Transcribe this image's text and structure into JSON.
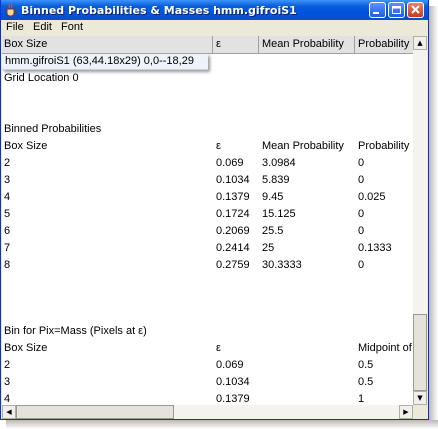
{
  "window": {
    "title": "Binned Probabilities & Masses hmm.gifroiS1"
  },
  "menu": [
    "File",
    "Edit",
    "Font"
  ],
  "header": [
    "Box Size",
    "ε",
    "Mean Probability",
    "Probability"
  ],
  "tooltip": {
    "text": "hmm.gifroiS1 (63,44.18x29) 0,0--18,29"
  },
  "grid_location": "Grid Location 0",
  "binned": {
    "title": "Binned Probabilities",
    "columns": [
      "Box Size",
      "ε",
      "Mean Probability",
      "Probability"
    ],
    "rows": [
      [
        "2",
        "0.069",
        "3.0984",
        "0"
      ],
      [
        "3",
        "0.1034",
        "5.839",
        "0"
      ],
      [
        "4",
        "0.1379",
        "9.45",
        "0.025"
      ],
      [
        "5",
        "0.1724",
        "15.125",
        "0"
      ],
      [
        "6",
        "0.2069",
        "25.5",
        "0"
      ],
      [
        "7",
        "0.2414",
        "25",
        "0.1333"
      ],
      [
        "8",
        "0.2759",
        "30.3333",
        "0"
      ]
    ]
  },
  "mass": {
    "title": "Bin for Pix=Mass (Pixels at ε)",
    "columns": [
      "Box Size",
      "ε",
      "Midpoint of"
    ],
    "rows": [
      [
        "2",
        "0.069",
        "0.5"
      ],
      [
        "3",
        "0.1034",
        "0.5"
      ],
      [
        "4",
        "0.1379",
        "1"
      ]
    ]
  },
  "scroll": {
    "up": "▲",
    "down": "▼",
    "left": "◀",
    "right": "▶"
  }
}
